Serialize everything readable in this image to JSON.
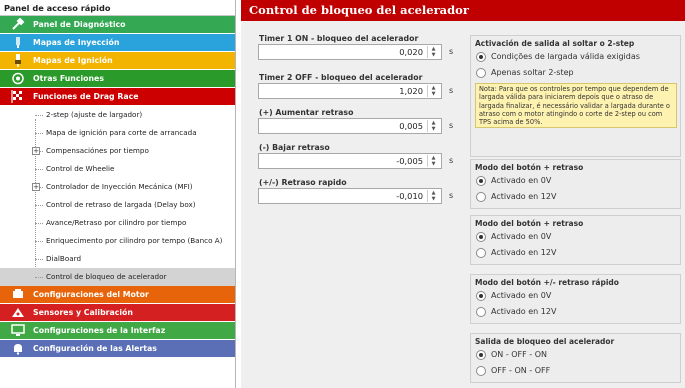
{
  "sidebar": {
    "header": "Panel de acceso rápido",
    "categories_top": [
      {
        "label": "Panel de Diagnóstico",
        "color": "#34a853",
        "icon": "wrench-icon"
      },
      {
        "label": "Mapas de Inyección",
        "color": "#2aa3dc",
        "icon": "fuel-injector-icon"
      },
      {
        "label": "Mapas de Ignición",
        "color": "#f3b400",
        "icon": "spark-plug-icon"
      },
      {
        "label": "Otras Funciones",
        "color": "#2a9a2a",
        "icon": "functions-icon"
      },
      {
        "label": "Funciones de Drag Race",
        "color": "#cc0000",
        "icon": "drag-race-flag-icon"
      }
    ],
    "subitems": [
      {
        "label": "2-step (ajuste de largador)",
        "expandable": false
      },
      {
        "label": "Mapa de ignición para corte de arrancada",
        "expandable": false
      },
      {
        "label": "Compensaciónes por tiempo",
        "expandable": true
      },
      {
        "label": "Control de Wheelie",
        "expandable": false
      },
      {
        "label": "Controlador de Inyección Mecánica (MFI)",
        "expandable": true
      },
      {
        "label": "Control de retraso de largada (Delay box)",
        "expandable": false
      },
      {
        "label": "Avance/Retraso por cilindro por tiempo",
        "expandable": false
      },
      {
        "label": "Enriquecimento por cilindro por tempo (Banco A)",
        "expandable": false
      },
      {
        "label": "DialBoard",
        "expandable": false
      },
      {
        "label": "Control de bloqueo de acelerador",
        "expandable": false,
        "selected": true
      }
    ],
    "categories_bottom": [
      {
        "label": "Configuraciones del Motor",
        "color": "#e8640a",
        "icon": "engine-icon"
      },
      {
        "label": "Sensores y Calibración",
        "color": "#d42020",
        "icon": "sensor-icon"
      },
      {
        "label": "Configuraciones de la Interfaz",
        "color": "#40a845",
        "icon": "monitor-icon"
      },
      {
        "label": "Configuración de las Alertas",
        "color": "#5a6fb5",
        "icon": "alert-bell-icon"
      }
    ]
  },
  "main": {
    "title": "Control de bloqueo del acelerador",
    "fields": [
      {
        "label": "Timer 1 ON - bloqueo del acelerador",
        "value": "0,020",
        "unit": "s"
      },
      {
        "label": "Timer 2 OFF - bloqueo del acelerador",
        "value": "1,020",
        "unit": "s"
      },
      {
        "label": "(+) Aumentar retraso",
        "value": "0,005",
        "unit": "s"
      },
      {
        "label": "(-) Bajar retraso",
        "value": "-0,005",
        "unit": "s"
      },
      {
        "label": "(+/-) Retraso rapido",
        "value": "-0,010",
        "unit": "s"
      }
    ],
    "groups": [
      {
        "title": "Activación de salida al soltar o 2-step",
        "options": [
          "Condições de largada válida exigidas",
          "Apenas soltar 2-step"
        ],
        "selected": 0,
        "note": "Nota: Para que os controles por tempo que dependem de largada válida para iniciarem depois que o atraso de largada finalizar, é necessário validar a largada durante o atraso com o motor atingindo o corte de 2-step ou com TPS acima de 50%."
      },
      {
        "title": "Modo del botón + retraso",
        "options": [
          "Activado en 0V",
          "Activado en 12V"
        ],
        "selected": 0
      },
      {
        "title": "Modo del botón + retraso",
        "options": [
          "Activado en 0V",
          "Activado en 12V"
        ],
        "selected": 0
      },
      {
        "title": "Modo del botón +/- retraso rápido",
        "options": [
          "Activado en 0V",
          "Activado en 12V"
        ],
        "selected": 0
      },
      {
        "title": "Salida de bloqueo del acelerador",
        "options": [
          "ON - OFF - ON",
          "OFF - ON - OFF"
        ],
        "selected": 0
      }
    ]
  }
}
